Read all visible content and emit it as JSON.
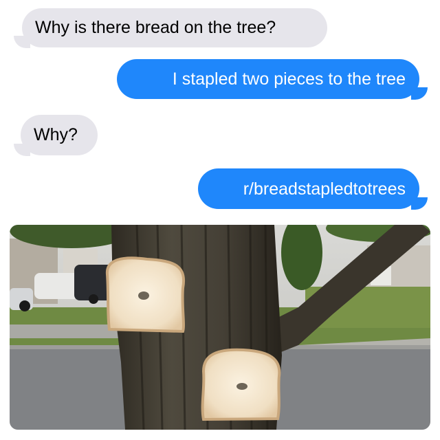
{
  "conversation": {
    "messages": [
      {
        "direction": "incoming",
        "text": "Why is there bread on the tree?"
      },
      {
        "direction": "outgoing",
        "text": "I stapled two pieces to the tree"
      },
      {
        "direction": "incoming",
        "text": "Why?"
      },
      {
        "direction": "outgoing",
        "text": "r/breadstapledtotrees"
      }
    ],
    "attachment": {
      "type": "photo",
      "subject": "two bread slices stapled to a tree trunk"
    }
  },
  "colors": {
    "incoming_bubble": "#e6e5eb",
    "outgoing_bubble": "#1f87fb",
    "incoming_text": "#000000",
    "outgoing_text": "#ffffff"
  }
}
